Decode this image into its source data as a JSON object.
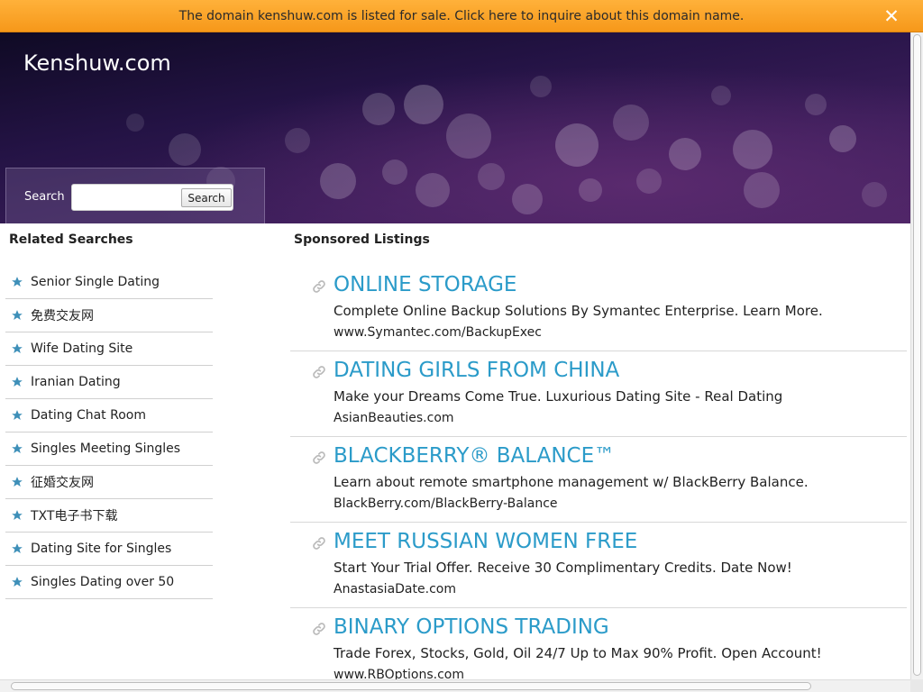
{
  "sale_bar": {
    "message": "The domain kenshuw.com is listed for sale. Click here to inquire about this domain name.",
    "close_label": "✕"
  },
  "header": {
    "site_title": "Kenshuw.com"
  },
  "search": {
    "label": "Search",
    "input_value": "",
    "button_label": "Search"
  },
  "related": {
    "heading": "Related Searches",
    "items": [
      "Senior Single Dating",
      "免费交友网",
      "Wife Dating Site",
      "Iranian Dating",
      "Dating Chat Room",
      "Singles Meeting Singles",
      "征婚交友网",
      "TXT电子书下载",
      "Dating Site for Singles",
      "Singles Dating over 50"
    ]
  },
  "sponsored": {
    "heading": "Sponsored Listings",
    "listings": [
      {
        "title": "ONLINE STORAGE",
        "description": "Complete Online Backup Solutions By Symantec Enterprise. Learn More.",
        "url": "www.Symantec.com/BackupExec"
      },
      {
        "title": "DATING GIRLS FROM CHINA",
        "description": "Make your Dreams Come True. Luxurious Dating Site - Real Dating",
        "url": "AsianBeauties.com"
      },
      {
        "title": "BLACKBERRY® BALANCE™",
        "description": "Learn about remote smartphone management w/ BlackBerry Balance.",
        "url": "BlackBerry.com/BlackBerry-Balance"
      },
      {
        "title": "MEET RUSSIAN WOMEN FREE",
        "description": "Start Your Trial Offer. Receive 30 Complimentary Credits. Date Now!",
        "url": "AnastasiaDate.com"
      },
      {
        "title": "BINARY OPTIONS TRADING",
        "description": "Trade Forex, Stocks, Gold, Oil 24/7 Up to Max 90% Profit. Open Account!",
        "url": "www.RBOptions.com"
      }
    ]
  },
  "colors": {
    "sale_bar": "#f6a024",
    "header_dark": "#1a0f35",
    "header_purple": "#4a2364",
    "link_blue": "#2b9bc9",
    "star_blue": "#3d8fb8"
  },
  "icons": {
    "close": "close-icon",
    "star": "star-icon",
    "link": "link-icon"
  }
}
